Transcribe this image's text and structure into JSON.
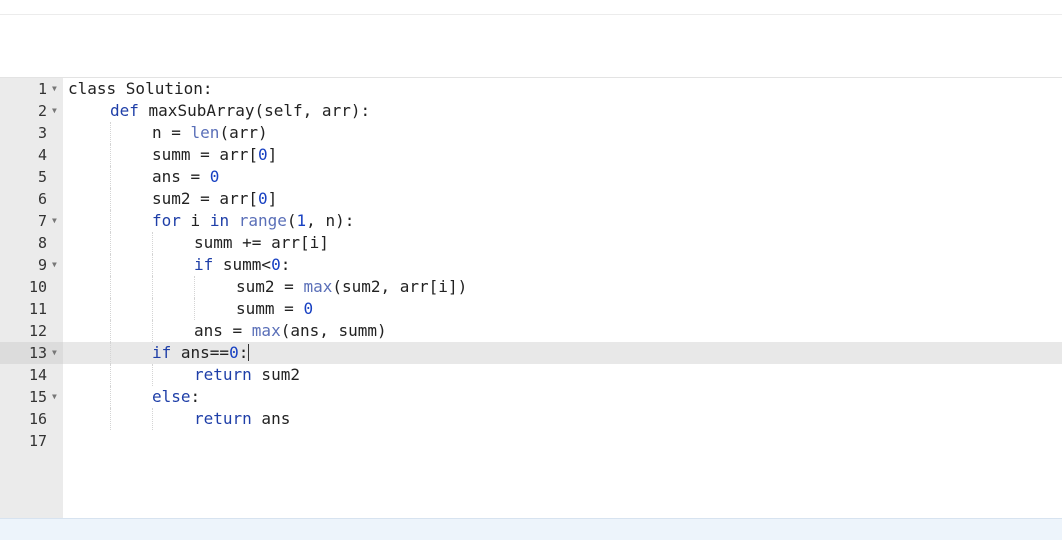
{
  "editor": {
    "active_line": 13,
    "lines": [
      {
        "num": "1",
        "fold": true,
        "indent": 0,
        "tokens": [
          {
            "t": "class Solution:",
            "c": ""
          }
        ]
      },
      {
        "num": "2",
        "fold": true,
        "indent": 1,
        "tokens": [
          {
            "t": "def",
            "c": "kw"
          },
          {
            "t": " maxSubArray(self, arr):",
            "c": ""
          }
        ]
      },
      {
        "num": "3",
        "fold": false,
        "indent": 2,
        "tokens": [
          {
            "t": "n = ",
            "c": ""
          },
          {
            "t": "len",
            "c": "bi"
          },
          {
            "t": "(arr)",
            "c": ""
          }
        ]
      },
      {
        "num": "4",
        "fold": false,
        "indent": 2,
        "tokens": [
          {
            "t": "summ = arr[",
            "c": ""
          },
          {
            "t": "0",
            "c": "num"
          },
          {
            "t": "]",
            "c": ""
          }
        ]
      },
      {
        "num": "5",
        "fold": false,
        "indent": 2,
        "tokens": [
          {
            "t": "ans = ",
            "c": ""
          },
          {
            "t": "0",
            "c": "num"
          }
        ]
      },
      {
        "num": "6",
        "fold": false,
        "indent": 2,
        "tokens": [
          {
            "t": "sum2 = arr[",
            "c": ""
          },
          {
            "t": "0",
            "c": "num"
          },
          {
            "t": "]",
            "c": ""
          }
        ]
      },
      {
        "num": "7",
        "fold": true,
        "indent": 2,
        "tokens": [
          {
            "t": "for",
            "c": "kw"
          },
          {
            "t": " i ",
            "c": ""
          },
          {
            "t": "in",
            "c": "kw"
          },
          {
            "t": " ",
            "c": ""
          },
          {
            "t": "range",
            "c": "bi"
          },
          {
            "t": "(",
            "c": ""
          },
          {
            "t": "1",
            "c": "num"
          },
          {
            "t": ", n):",
            "c": ""
          }
        ]
      },
      {
        "num": "8",
        "fold": false,
        "indent": 3,
        "tokens": [
          {
            "t": "summ += arr[i]",
            "c": ""
          }
        ]
      },
      {
        "num": "9",
        "fold": true,
        "indent": 3,
        "tokens": [
          {
            "t": "if",
            "c": "kw"
          },
          {
            "t": " summ<",
            "c": ""
          },
          {
            "t": "0",
            "c": "num"
          },
          {
            "t": ":",
            "c": ""
          }
        ]
      },
      {
        "num": "10",
        "fold": false,
        "indent": 4,
        "tokens": [
          {
            "t": "sum2 = ",
            "c": ""
          },
          {
            "t": "max",
            "c": "bi"
          },
          {
            "t": "(sum2, arr[i])",
            "c": ""
          }
        ]
      },
      {
        "num": "11",
        "fold": false,
        "indent": 4,
        "tokens": [
          {
            "t": "summ = ",
            "c": ""
          },
          {
            "t": "0",
            "c": "num"
          }
        ]
      },
      {
        "num": "12",
        "fold": false,
        "indent": 3,
        "tokens": [
          {
            "t": "ans = ",
            "c": ""
          },
          {
            "t": "max",
            "c": "bi"
          },
          {
            "t": "(ans, summ)",
            "c": ""
          }
        ]
      },
      {
        "num": "13",
        "fold": true,
        "indent": 2,
        "tokens": [
          {
            "t": "if",
            "c": "kw"
          },
          {
            "t": " ans==",
            "c": ""
          },
          {
            "t": "0",
            "c": "num"
          },
          {
            "t": ":",
            "c": ""
          }
        ]
      },
      {
        "num": "14",
        "fold": false,
        "indent": 3,
        "tokens": [
          {
            "t": "return",
            "c": "kw"
          },
          {
            "t": " sum2",
            "c": ""
          }
        ]
      },
      {
        "num": "15",
        "fold": true,
        "indent": 2,
        "tokens": [
          {
            "t": "else",
            "c": "kw"
          },
          {
            "t": ":",
            "c": ""
          }
        ]
      },
      {
        "num": "16",
        "fold": false,
        "indent": 3,
        "tokens": [
          {
            "t": "return",
            "c": "kw"
          },
          {
            "t": " ans",
            "c": ""
          }
        ]
      },
      {
        "num": "17",
        "fold": false,
        "indent": 0,
        "tokens": []
      }
    ]
  },
  "icons": {
    "fold_marker": "fold-arrow-icon"
  },
  "colors": {
    "keyword": "#1f3fa8",
    "builtin": "#5a6fb8",
    "number": "#1740c2",
    "gutter": "#ebebeb",
    "active_line": "#e8e8e8"
  }
}
